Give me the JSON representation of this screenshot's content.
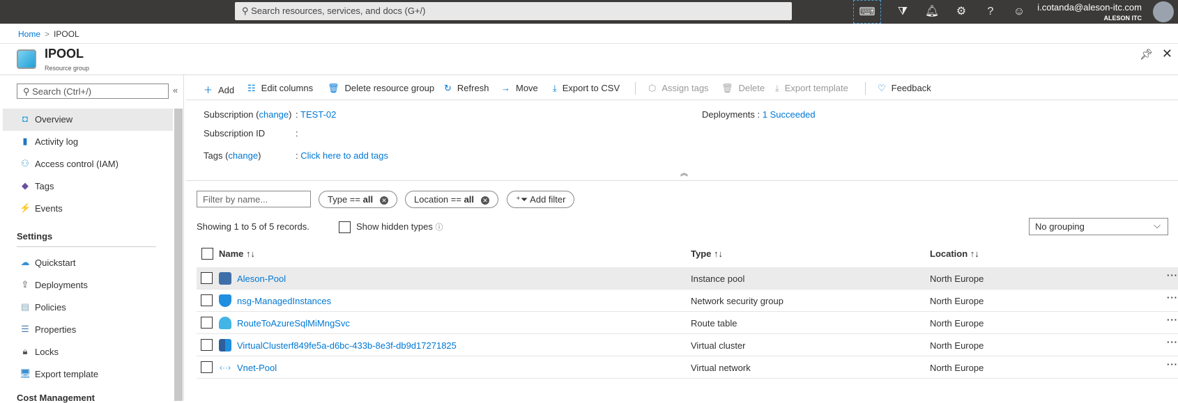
{
  "topbar": {
    "search_placeholder": "Search resources, services, and docs (G+/)",
    "user_email": "i.cotanda@aleson-itc.com",
    "tenant": "ALESON ITC"
  },
  "breadcrumb": {
    "home": "Home",
    "current": "IPOOL"
  },
  "header": {
    "title": "IPOOL",
    "subtitle": "Resource group"
  },
  "sidebar": {
    "search_placeholder": "Search (Ctrl+/)",
    "items": [
      {
        "label": "Overview"
      },
      {
        "label": "Activity log"
      },
      {
        "label": "Access control (IAM)"
      },
      {
        "label": "Tags"
      },
      {
        "label": "Events"
      }
    ],
    "settings_heading": "Settings",
    "settings": [
      {
        "label": "Quickstart"
      },
      {
        "label": "Deployments"
      },
      {
        "label": "Policies"
      },
      {
        "label": "Properties"
      },
      {
        "label": "Locks"
      },
      {
        "label": "Export template"
      }
    ],
    "cost_heading": "Cost Management"
  },
  "toolbar": {
    "add": "Add",
    "edit_columns": "Edit columns",
    "delete_rg": "Delete resource group",
    "refresh": "Refresh",
    "move": "Move",
    "export_csv": "Export to CSV",
    "assign_tags": "Assign tags",
    "delete": "Delete",
    "export_template": "Export template",
    "feedback": "Feedback"
  },
  "essentials": {
    "subscription_label": "Subscription (",
    "change": "change",
    "close_paren": ")",
    "subscription_value": "TEST-02",
    "subscription_id_label": "Subscription ID",
    "tags_label": "Tags (",
    "tags_value": "Click here to add tags",
    "colon": ":",
    "deployments_label": "Deployments",
    "deployments_value": "1 Succeeded"
  },
  "filters": {
    "name_placeholder": "Filter by name...",
    "type_label": "Type ==",
    "type_value": "all",
    "location_label": "Location ==",
    "location_value": "all",
    "add_filter": "Add filter",
    "showing": "Showing 1 to 5 of 5 records.",
    "show_hidden": "Show hidden types",
    "grouping": "No grouping"
  },
  "table": {
    "headers": {
      "name": "Name",
      "type": "Type",
      "location": "Location"
    },
    "rows": [
      {
        "name": "Aleson-Pool",
        "type": "Instance pool",
        "location": "North Europe"
      },
      {
        "name": "nsg-ManagedInstances",
        "type": "Network security group",
        "location": "North Europe"
      },
      {
        "name": "RouteToAzureSqlMiMngSvc",
        "type": "Route table",
        "location": "North Europe"
      },
      {
        "name": "VirtualClusterf849fe5a-d6bc-433b-8e3f-db9d17271825",
        "type": "Virtual cluster",
        "location": "North Europe"
      },
      {
        "name": "Vnet-Pool",
        "type": "Virtual network",
        "location": "North Europe"
      }
    ]
  }
}
